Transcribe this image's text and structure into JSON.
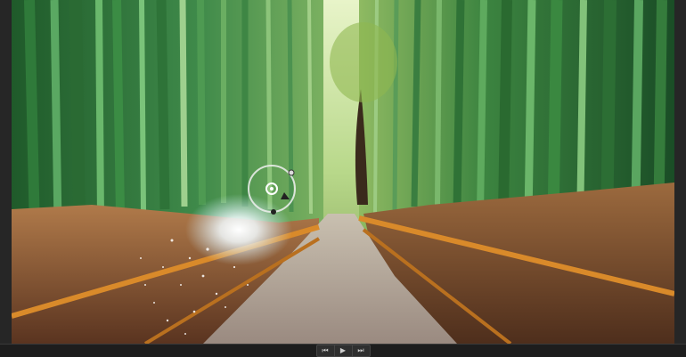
{
  "viewer": {
    "image_description_icon": "bamboo-forest-path-photo",
    "effect_widget_icon": "light-burst-position-gizmo"
  },
  "transport": {
    "prev_label": "⏮",
    "play_label": "▶",
    "next_label": "⏭"
  },
  "colors": {
    "ui_background": "#2b2b2b",
    "transport_bar": "#1d1d1d",
    "bamboo_green": "#3f8a3c",
    "grass_brown": "#8a5a32",
    "path_grey": "#b7a89c"
  }
}
